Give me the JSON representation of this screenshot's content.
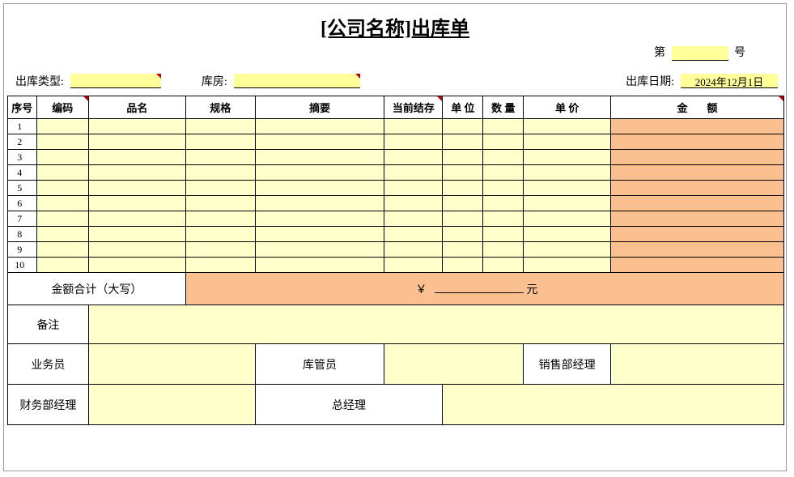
{
  "title": "[公司名称]出库单",
  "sheet_no": {
    "prefix": "第",
    "value": "",
    "suffix": "号"
  },
  "meta": {
    "type_label": "出库类型:",
    "type_value": "",
    "warehouse_label": "库房:",
    "warehouse_value": "",
    "date_label": "出库日期:",
    "date_value": "2024年12月1日"
  },
  "headers": {
    "seq": "序号",
    "code": "编码",
    "name": "品名",
    "spec": "规格",
    "summary": "摘要",
    "stock": "当前结存",
    "unit": "单 位",
    "qty": "数 量",
    "price": "单 价",
    "amount": "金额"
  },
  "rows": [
    {
      "seq": "1",
      "code": "",
      "name": "",
      "spec": "",
      "summary": "",
      "stock": "",
      "unit": "",
      "qty": "",
      "price": "",
      "amount": ""
    },
    {
      "seq": "2",
      "code": "",
      "name": "",
      "spec": "",
      "summary": "",
      "stock": "",
      "unit": "",
      "qty": "",
      "price": "",
      "amount": ""
    },
    {
      "seq": "3",
      "code": "",
      "name": "",
      "spec": "",
      "summary": "",
      "stock": "",
      "unit": "",
      "qty": "",
      "price": "",
      "amount": ""
    },
    {
      "seq": "4",
      "code": "",
      "name": "",
      "spec": "",
      "summary": "",
      "stock": "",
      "unit": "",
      "qty": "",
      "price": "",
      "amount": ""
    },
    {
      "seq": "5",
      "code": "",
      "name": "",
      "spec": "",
      "summary": "",
      "stock": "",
      "unit": "",
      "qty": "",
      "price": "",
      "amount": ""
    },
    {
      "seq": "6",
      "code": "",
      "name": "",
      "spec": "",
      "summary": "",
      "stock": "",
      "unit": "",
      "qty": "",
      "price": "",
      "amount": ""
    },
    {
      "seq": "7",
      "code": "",
      "name": "",
      "spec": "",
      "summary": "",
      "stock": "",
      "unit": "",
      "qty": "",
      "price": "",
      "amount": ""
    },
    {
      "seq": "8",
      "code": "",
      "name": "",
      "spec": "",
      "summary": "",
      "stock": "",
      "unit": "",
      "qty": "",
      "price": "",
      "amount": ""
    },
    {
      "seq": "9",
      "code": "",
      "name": "",
      "spec": "",
      "summary": "",
      "stock": "",
      "unit": "",
      "qty": "",
      "price": "",
      "amount": ""
    },
    {
      "seq": "10",
      "code": "",
      "name": "",
      "spec": "",
      "summary": "",
      "stock": "",
      "unit": "",
      "qty": "",
      "price": "",
      "amount": ""
    }
  ],
  "total": {
    "label": "金额合计（大写）",
    "currency": "￥",
    "suffix": "元"
  },
  "remark_label": "备注",
  "remark_value": "",
  "signatures": {
    "biz": "业务员",
    "wh": "库管员",
    "sales_mgr": "销售部经理",
    "fin_mgr": "财务部经理",
    "gm": "总经理"
  }
}
